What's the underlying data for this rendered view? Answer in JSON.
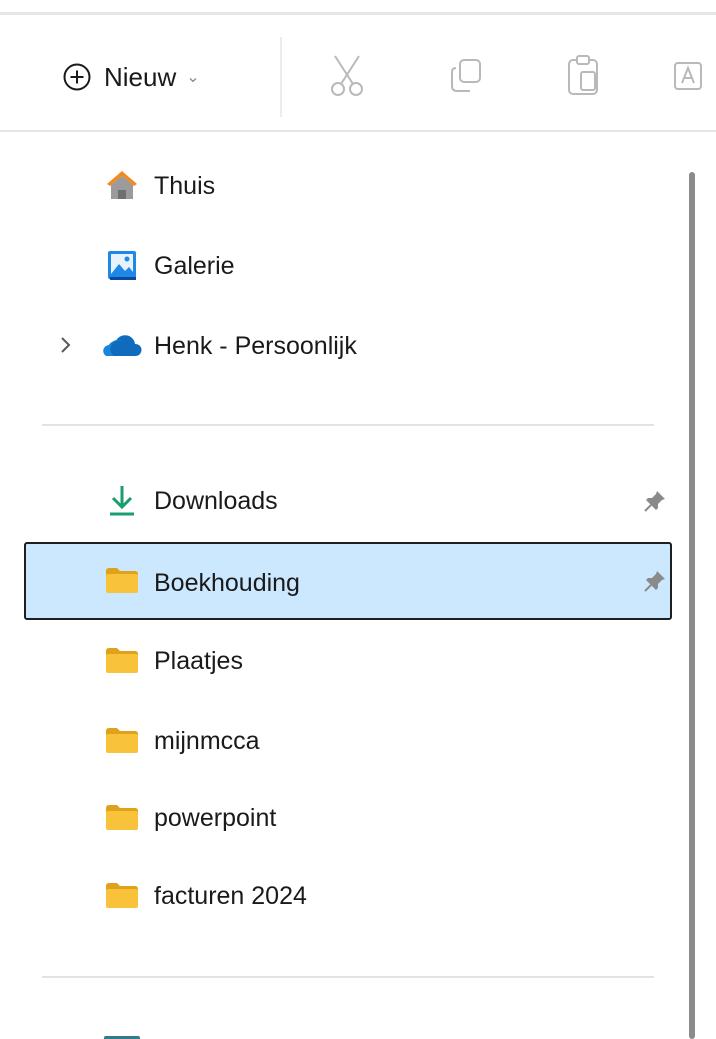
{
  "toolbar": {
    "new_label": "Nieuw",
    "new_chevron": "⌄",
    "icons": [
      "cut-icon",
      "copy-icon",
      "paste-icon",
      "rename-icon"
    ]
  },
  "nav": {
    "quick": [
      {
        "label": "Thuis",
        "icon": "home-icon"
      },
      {
        "label": "Galerie",
        "icon": "gallery-icon"
      },
      {
        "label": "Henk - Persoonlijk",
        "icon": "onedrive-cloud-icon",
        "expander": "›"
      }
    ],
    "pinned": [
      {
        "label": "Downloads",
        "icon": "download-icon",
        "pinned": true
      },
      {
        "label": "Boekhouding",
        "icon": "folder-icon",
        "pinned": true,
        "selected": true
      },
      {
        "label": "Plaatjes",
        "icon": "folder-icon"
      },
      {
        "label": "mijnmcca",
        "icon": "folder-icon"
      },
      {
        "label": "powerpoint",
        "icon": "folder-icon"
      },
      {
        "label": "facturen 2024",
        "icon": "folder-icon"
      }
    ]
  },
  "colors": {
    "selection_bg": "#cce8ff",
    "folder_yellow": "#f8c23a",
    "download_green": "#1a9e6e",
    "onedrive_blue": "#0f6cbd",
    "home_orange": "#f08a24"
  }
}
